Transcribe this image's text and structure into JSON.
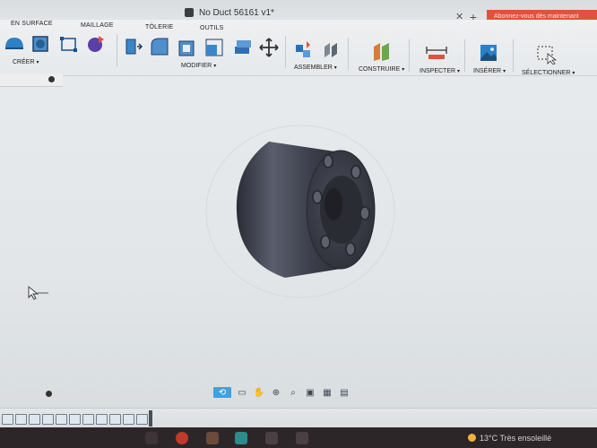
{
  "window": {
    "title": "No Duct 56161 v1*",
    "close_glyph": "✕",
    "new_tab_glyph": "+",
    "subscribe_banner": "Abonnez-vous dès maintenant"
  },
  "ribbon": {
    "tabs": [
      "EN SURFACE",
      "MAILLAGE",
      "TÔLERIE",
      "OUTILS"
    ],
    "groups": {
      "create": "CRÉER",
      "modify": "MODIFIER",
      "assemble": "ASSEMBLER",
      "construct": "CONSTRUIRE",
      "inspect": "INSPECTER",
      "insert": "INSÉRER",
      "select": "SÉLECTIONNER"
    },
    "caret": "▾"
  },
  "navigation_bar": {
    "icons": [
      "orbit-icon",
      "look-at-icon",
      "pan-icon",
      "zoom-icon",
      "zoom-window-icon",
      "display-settings-icon",
      "grid-settings-icon",
      "viewports-icon"
    ]
  },
  "taskbar": {
    "weather_temp": "13°C",
    "weather_text": "Très ensoleillé"
  },
  "colors": {
    "accent_blue": "#3da2e0",
    "banner_orange": "#e0533a",
    "model_dark": "#3b3d48"
  }
}
